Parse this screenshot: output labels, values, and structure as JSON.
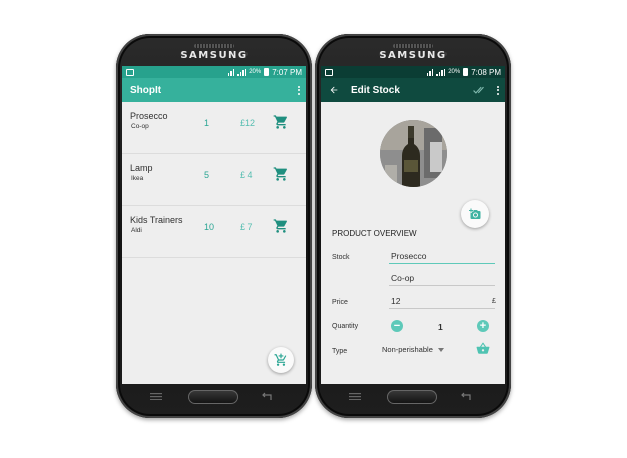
{
  "colors": {
    "teal_status": "#27a28d",
    "teal_appbar": "#36b19c",
    "dark_green_status": "#0b3d34",
    "dark_green_appbar": "#0f4a3f",
    "accent": "#4fc3b2",
    "screen_bg": "#eeeeee"
  },
  "brand": "SAMSUNG",
  "phone_left": {
    "status": {
      "time": "7:07 PM",
      "battery": "20%"
    },
    "appbar": {
      "title": "ShopIt",
      "menu_icon": "overflow-menu-icon"
    },
    "items": [
      {
        "name": "Prosecco",
        "store": "Co-op",
        "qty": "1",
        "price": "£12",
        "icon": "cart-icon"
      },
      {
        "name": "Lamp",
        "store": "Ikea",
        "qty": "5",
        "price": "£ 4",
        "icon": "cart-icon"
      },
      {
        "name": "Kids Trainers",
        "store": "Aldi",
        "qty": "10",
        "price": "£ 7",
        "icon": "cart-icon"
      }
    ],
    "fab_icon": "add-to-cart-icon"
  },
  "phone_right": {
    "status": {
      "time": "7:08 PM",
      "battery": "20%"
    },
    "appbar": {
      "title": "Edit Stock",
      "back_icon": "arrow-back-icon",
      "confirm_icon": "double-check-icon",
      "menu_icon": "overflow-menu-icon"
    },
    "camera_icon": "add-photo-icon",
    "section_title": "PRODUCT OVERVIEW",
    "form": {
      "stock_label": "Stock",
      "stock_value": "Prosecco",
      "store_value": "Co-op",
      "price_label": "Price",
      "price_value": "12",
      "currency": "£",
      "quantity_label": "Quantity",
      "quantity_value": "1",
      "minus": "−",
      "plus": "+",
      "type_label": "Type",
      "type_value": "Non-perishable",
      "basket_icon": "basket-icon"
    }
  }
}
